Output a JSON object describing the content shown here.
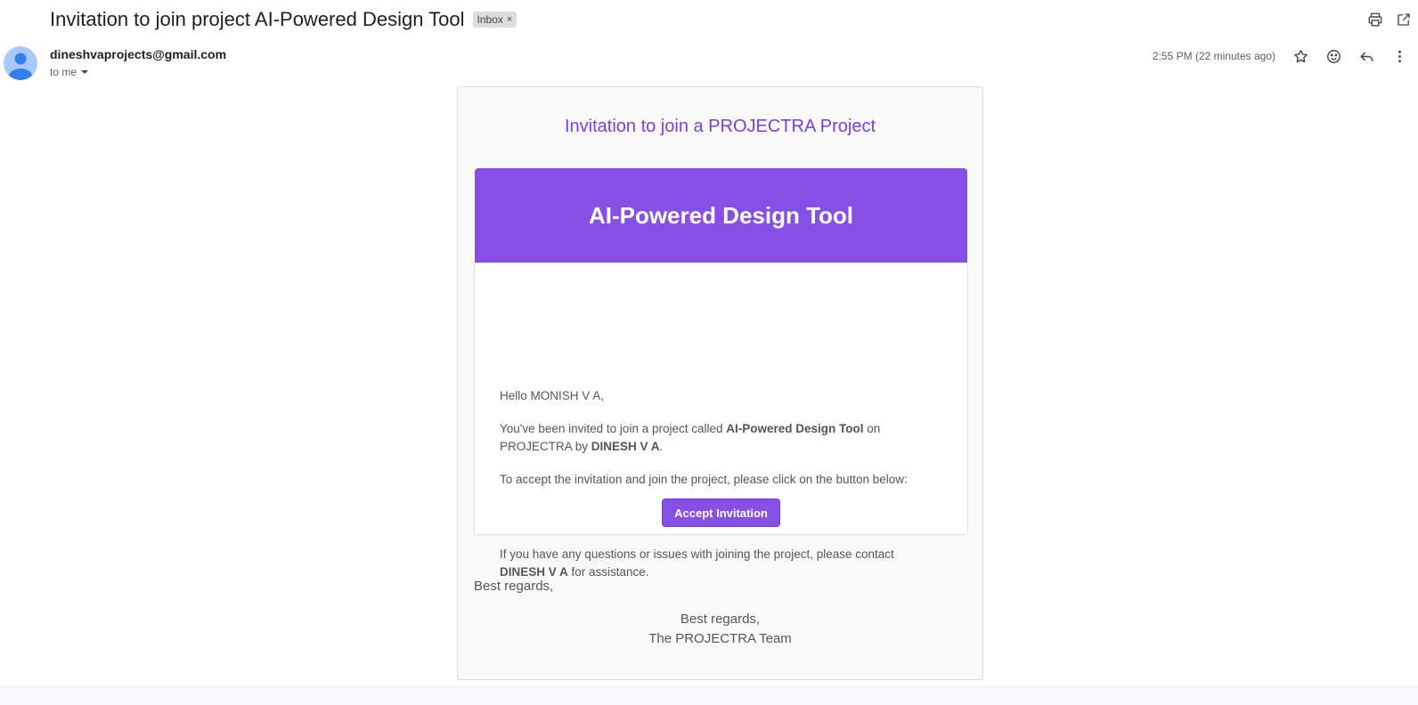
{
  "header": {
    "subject": "Invitation to join project AI-Powered Design Tool",
    "label": "Inbox",
    "label_remove": "×",
    "icons": [
      "print-icon",
      "open-in-new-window-icon"
    ]
  },
  "sender": {
    "email": "dineshvaprojects@gmail.com",
    "recipient": "to me",
    "timestamp": "2:55 PM (22 minutes ago)",
    "icons": [
      "star-icon",
      "emoji-icon",
      "reply-icon",
      "more-vert-icon"
    ]
  },
  "email": {
    "heading": "Invitation to join a PROJECTRA Project",
    "banner_title": "AI-Powered Design Tool",
    "greeting": "Hello MONISH V A,",
    "invite_pre": "You've been invited to join a project called ",
    "project_name": "AI-Powered Design Tool",
    "invite_mid": " on PROJECTRA by ",
    "inviter": "DINESH V A",
    "invite_end": ".",
    "instruction": "To accept the invitation and join the project, please click on the button below:",
    "accept_button": "Accept Invitation",
    "contact_pre": "If you have any questions or issues with joining the project, please contact ",
    "contact_name": "DINESH V A",
    "contact_post": " for assistance.",
    "regards_left": "Best regards,",
    "regards_center": "Best regards,",
    "team": "The PROJECTRA Team"
  },
  "colors": {
    "accent": "#8650e6",
    "heading": "#7a3fe0",
    "card_bg": "#f9f9f9"
  }
}
